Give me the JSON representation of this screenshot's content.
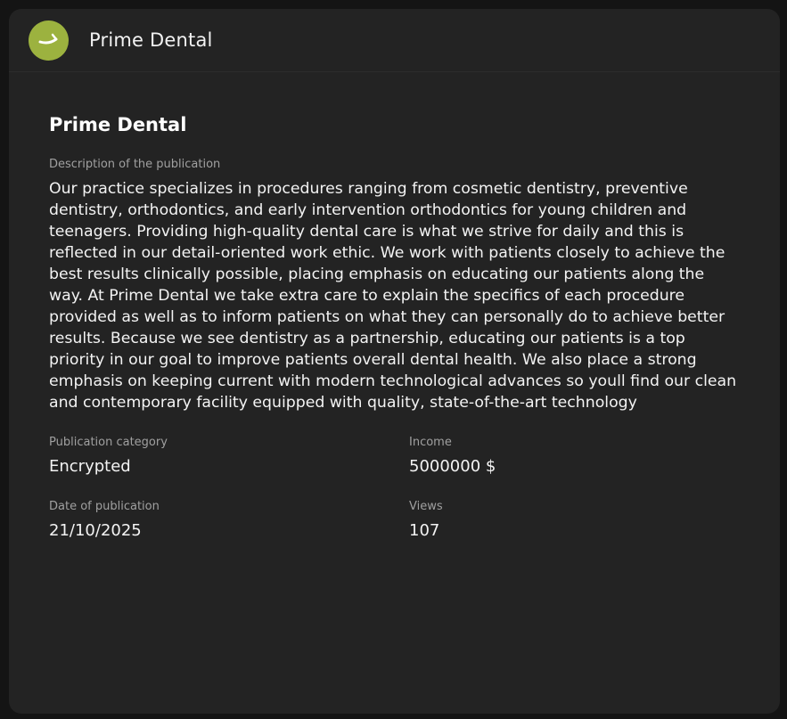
{
  "header": {
    "title": "Prime Dental",
    "logo_icon": "tooth-smile-icon",
    "logo_color": "#9cb23f"
  },
  "publication": {
    "title": "Prime Dental",
    "description_label": "Description of the publication",
    "description": "Our practice specializes in procedures ranging from cosmetic dentistry, preventive dentistry, orthodontics, and early intervention orthodontics for young children and teenagers. Providing high-quality dental care is what we strive for daily and this is reflected in our detail-oriented work ethic. We work with patients closely to achieve the best results clinically possible, placing emphasis on educating our patients along the way. At Prime Dental we take extra care to explain the specifics of each procedure provided as well as to inform patients on what they can personally do to achieve better results. Because we see dentistry as a partnership, educating our patients is a top priority in our goal to improve patients overall dental health. We also place a strong emphasis on keeping current with modern technological advances so youll find our clean and contemporary facility equipped with quality, state-of-the-art technology",
    "category_label": "Publication category",
    "category": "Encrypted",
    "income_label": "Income",
    "income": "5000000 $",
    "date_label": "Date of publication",
    "date": "21/10/2025",
    "views_label": "Views",
    "views": "107"
  }
}
